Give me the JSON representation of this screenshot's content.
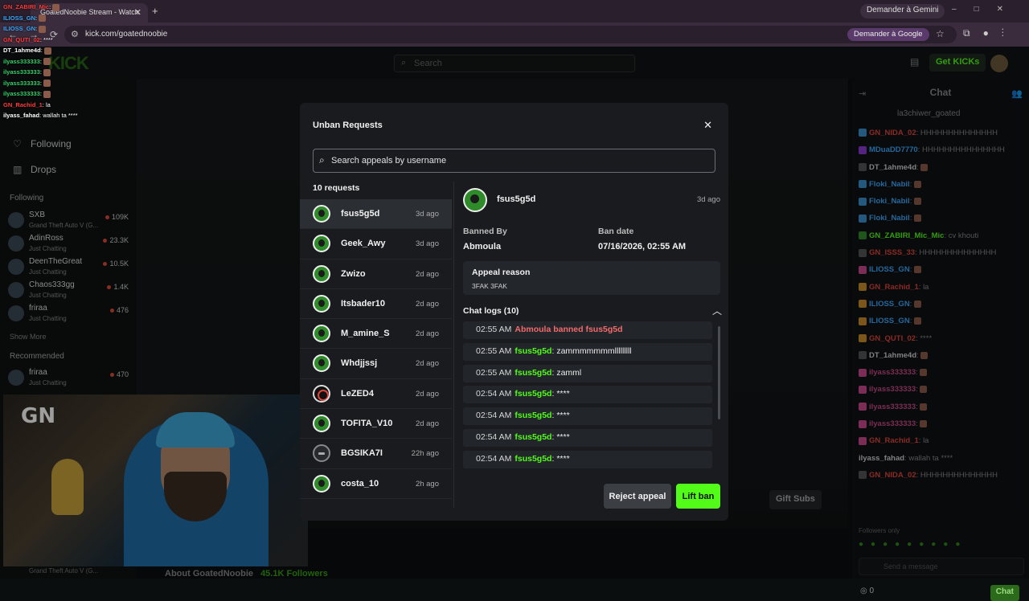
{
  "browser": {
    "tab_title": "GoatedNoobie Stream - Watch",
    "new_tab": "+",
    "gemini_top": "Demander à Gemini",
    "url": "kick.com/goatednoobie",
    "gemini_addr": "Demander à Google"
  },
  "topnav": {
    "logo": "KICK",
    "search_placeholder": "Search",
    "get_kicks": "Get KICKs"
  },
  "sidebar": {
    "nav": [
      {
        "label": "Following",
        "icon": "heart-icon"
      },
      {
        "label": "Drops",
        "icon": "drops-icon"
      }
    ],
    "following_header": "Following",
    "following": [
      {
        "name": "SXB",
        "sub": "Grand Theft Auto V (G...",
        "viewers": "109K"
      },
      {
        "name": "AdinRoss",
        "sub": "Just Chatting",
        "viewers": "23.3K"
      },
      {
        "name": "DeenTheGreat",
        "sub": "Just Chatting",
        "viewers": "10.5K"
      },
      {
        "name": "Chaos333gg",
        "sub": "Just Chatting",
        "viewers": "1.4K"
      },
      {
        "name": "friraa",
        "sub": "Just Chatting",
        "viewers": "476"
      }
    ],
    "show_more": "Show More",
    "recommended_header": "Recommended",
    "recommended": [
      {
        "name": "friraa",
        "sub": "Just Chatting",
        "viewers": "470"
      }
    ],
    "bottom_sub": "Grand Theft Auto V (G..."
  },
  "stream": {
    "gift_subs": "Gift Subs",
    "about": "About GoatedNoobie",
    "followers": "45.1K Followers",
    "cam_logo": "GN"
  },
  "overlay_chat": [
    {
      "user": "GN_ZABIRI_Mic",
      "text": "",
      "color": "#ff3b3b"
    },
    {
      "user": "ILIOSS_GN",
      "text": "",
      "color": "#3ba8ff"
    },
    {
      "user": "ILIOSS_GN",
      "text": "",
      "color": "#3ba8ff"
    },
    {
      "user": "GN_QUTI_02",
      "text": "****",
      "color": "#ff3b3b"
    },
    {
      "user": "DT_1ahme4d",
      "text": "",
      "color": "#ffffff"
    },
    {
      "user": "ilyass333333",
      "text": "",
      "color": "#35d06a"
    },
    {
      "user": "ilyass333333",
      "text": "",
      "color": "#35d06a"
    },
    {
      "user": "ilyass333333",
      "text": "",
      "color": "#35d06a"
    },
    {
      "user": "ilyass333333",
      "text": "",
      "color": "#35d06a"
    },
    {
      "user": "GN_Rachid_1",
      "text": "la",
      "color": "#ff3b3b"
    },
    {
      "user": "ilyass_fahad",
      "text": "wallah ta ****",
      "color": "#ffffff"
    }
  ],
  "chat": {
    "title": "Chat",
    "pinned": "la3chiwer_goated",
    "messages": [
      {
        "user": "GN_NIDA_02",
        "text": "HHHHHHHHHHHHHH",
        "color": "#e0453c",
        "badge": "#3b8ec8"
      },
      {
        "user": "MDuaDD7770",
        "text": "HHHHHHHHHHHHHHH",
        "color": "#3ba8ff",
        "badge": "#8a3ad0"
      },
      {
        "user": "DT_1ahme4d",
        "text": "",
        "color": "#cfcfcf",
        "badge": "#555"
      },
      {
        "user": "Floki_Nabil",
        "text": "",
        "color": "#3ba8ff",
        "badge": "#3b8ec8"
      },
      {
        "user": "Floki_Nabil",
        "text": "",
        "color": "#3ba8ff",
        "badge": "#3b8ec8"
      },
      {
        "user": "Floki_Nabil",
        "text": "",
        "color": "#3ba8ff",
        "badge": "#3b8ec8"
      },
      {
        "user": "GN_ZABIRI_Mic_Mic",
        "text": "cv khouti",
        "color": "#53fc18",
        "badge": "#2f8a2a"
      },
      {
        "user": "GN_ISSS_33",
        "text": "HHHHHHHHHHHHHH",
        "color": "#e0453c",
        "badge": "#555"
      },
      {
        "user": "ILIOSS_GN",
        "text": "",
        "color": "#3ba8ff",
        "badge": "#c84a8a"
      },
      {
        "user": "GN_Rachid_1",
        "text": "la",
        "color": "#e0453c",
        "badge": "#c88a2a"
      },
      {
        "user": "ILIOSS_GN",
        "text": "",
        "color": "#3ba8ff",
        "badge": "#c88a2a"
      },
      {
        "user": "ILIOSS_GN",
        "text": "",
        "color": "#3ba8ff",
        "badge": "#c88a2a"
      },
      {
        "user": "GN_QUTI_02",
        "text": "****",
        "color": "#e0453c",
        "badge": "#c88a2a"
      },
      {
        "user": "DT_1ahme4d",
        "text": "",
        "color": "#cfcfcf",
        "badge": "#555"
      },
      {
        "user": "ilyass333333",
        "text": "",
        "color": "#c84a8a",
        "badge": "#c84a8a"
      },
      {
        "user": "ilyass333333",
        "text": "",
        "color": "#c84a8a",
        "badge": "#c84a8a"
      },
      {
        "user": "ilyass333333",
        "text": "",
        "color": "#c84a8a",
        "badge": "#c84a8a"
      },
      {
        "user": "ilyass333333",
        "text": "",
        "color": "#c84a8a",
        "badge": "#c84a8a"
      },
      {
        "user": "GN_Rachid_1",
        "text": "la",
        "color": "#e0453c",
        "badge": "#c84a8a"
      },
      {
        "user": "ilyass_fahad",
        "text": "wallah ta ****",
        "color": "#cfcfcf",
        "badge": ""
      },
      {
        "user": "GN_NIDA_02",
        "text": "HHHHHHHHHHHHHH",
        "color": "#e0453c",
        "badge": "#555"
      }
    ],
    "followers_only": "Followers only",
    "input_placeholder": "Send a message",
    "points": "0",
    "send": "Chat"
  },
  "modal": {
    "title": "Unban Requests",
    "close": "✕",
    "search_placeholder": "Search appeals by username",
    "count_label": "10 requests",
    "requests": [
      {
        "name": "fsus5g5d",
        "time": "3d ago",
        "avatar": "green",
        "selected": true
      },
      {
        "name": "Geek_Awy",
        "time": "3d ago",
        "avatar": "green"
      },
      {
        "name": "Zwizo",
        "time": "2d ago",
        "avatar": "green"
      },
      {
        "name": "Itsbader10",
        "time": "2d ago",
        "avatar": "green"
      },
      {
        "name": "M_amine_S",
        "time": "2d ago",
        "avatar": "green"
      },
      {
        "name": "Whdjjssj",
        "time": "2d ago",
        "avatar": "green"
      },
      {
        "name": "LeZED4",
        "time": "2d ago",
        "avatar": "red"
      },
      {
        "name": "TOFITA_V10",
        "time": "2d ago",
        "avatar": "green"
      },
      {
        "name": "BGSIKA7I",
        "time": "22h ago",
        "avatar": "dark"
      },
      {
        "name": "costa_10",
        "time": "2h ago",
        "avatar": "green"
      }
    ],
    "detail": {
      "name": "fsus5g5d",
      "time": "3d ago",
      "banned_by_label": "Banned By",
      "banned_by": "Abmoula",
      "ban_date_label": "Ban date",
      "ban_date": "07/16/2026, 02:55 AM",
      "appeal_label": "Appeal reason",
      "appeal_text": "3FAK 3FAK",
      "logs_label": "Chat logs (10)",
      "logs": [
        {
          "time": "02:55 AM",
          "system": "Abmoula banned fsus5g5d"
        },
        {
          "time": "02:55 AM",
          "user": "fsus5g5d",
          "text": "zammmmmmmlllllllll"
        },
        {
          "time": "02:55 AM",
          "user": "fsus5g5d",
          "text": "zamml"
        },
        {
          "time": "02:54 AM",
          "user": "fsus5g5d",
          "text": "****"
        },
        {
          "time": "02:54 AM",
          "user": "fsus5g5d",
          "text": "****"
        },
        {
          "time": "02:54 AM",
          "user": "fsus5g5d",
          "text": "****"
        },
        {
          "time": "02:54 AM",
          "user": "fsus5g5d",
          "text": "****"
        }
      ]
    },
    "reject_label": "Reject appeal",
    "lift_label": "Lift ban"
  }
}
